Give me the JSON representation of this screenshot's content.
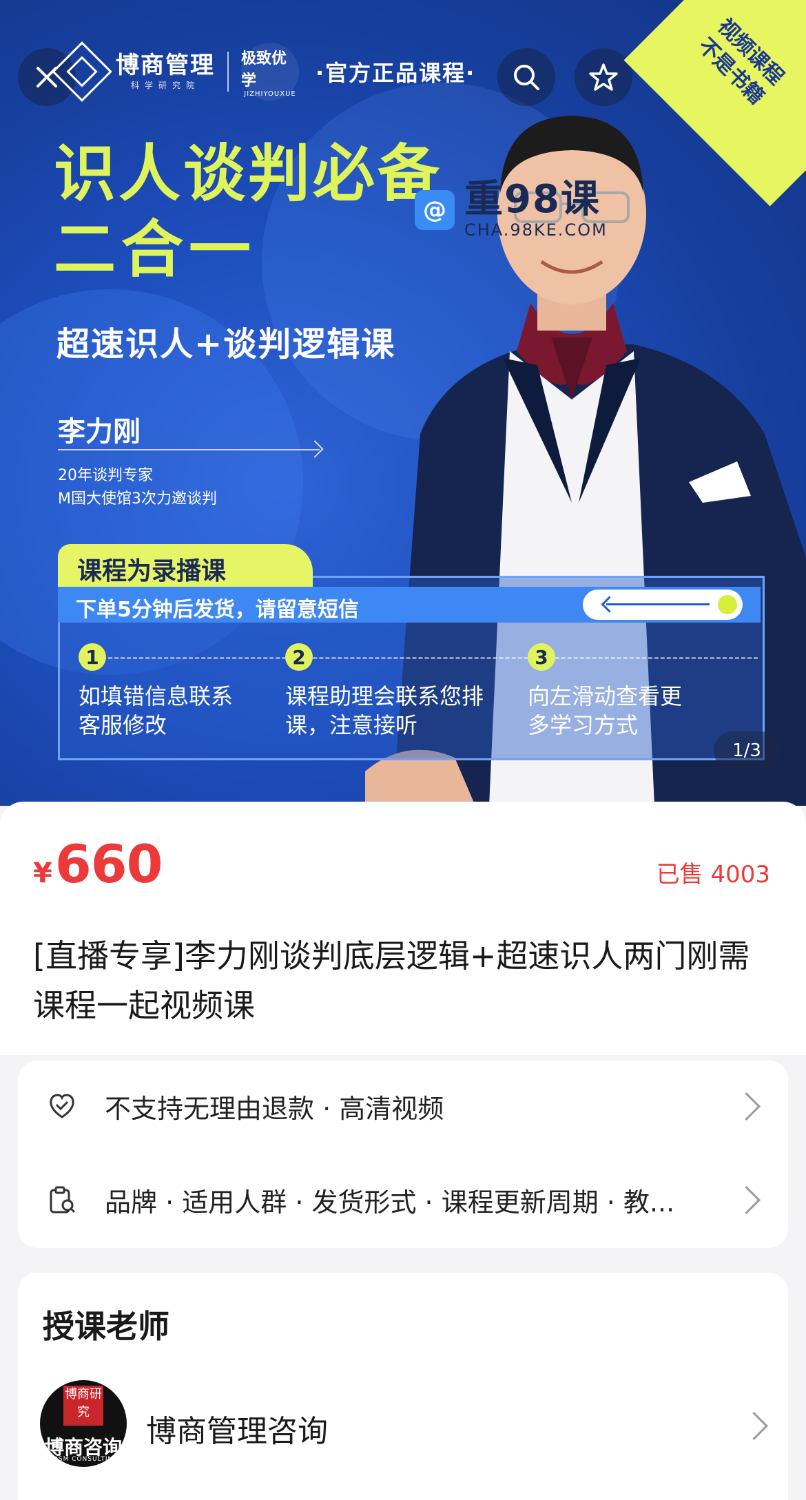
{
  "banner": {
    "brand_name": "博商管理",
    "brand_sub": "科学研究院",
    "partner_name": "极致优学",
    "partner_sub": "JIZHIYOUXUE",
    "official_label": "·官方正品课程·",
    "corner_tag_line1": "视频课程",
    "corner_tag_line2": "不是书籍",
    "headline_line1": "识人谈判必备",
    "headline_line2": "二合一",
    "subheadline": "超速识人+谈判逻辑课",
    "watermark_main": "重98课",
    "watermark_url": "CHA.98KE.COM",
    "teacher_name": "李力刚",
    "teacher_desc1": "20年谈判专家",
    "teacher_desc2": "M国大使馆3次力邀谈判",
    "notice_tab": "课程为录播课",
    "notice_strip": "下单5分钟后发货，请留意短信",
    "steps": [
      {
        "num": "1",
        "text": "如填错信息联系客服修改"
      },
      {
        "num": "2",
        "text": "课程助理会联系您排课，注意接听"
      },
      {
        "num": "3",
        "text": "向左滑动查看更多学习方式"
      }
    ],
    "pager": "1/3",
    "icons": {
      "close": "close-icon",
      "search": "search-icon",
      "favorite": "star-icon",
      "share": "share-icon",
      "more": "more-icon"
    }
  },
  "product": {
    "currency": "¥",
    "price": "660",
    "sold": "已售 4003",
    "title": "[直播专享]李力刚谈判底层逻辑+超速识人两门刚需课程一起视频课"
  },
  "info": {
    "service_text": "不支持无理由退款 · 高清视频",
    "params_text": "品牌 · 适用人群 · 发货形式 · 课程更新周期 · 教..."
  },
  "teacher": {
    "section_title": "授课老师",
    "name": "博商管理咨询",
    "avatar_seal": "博商研究",
    "avatar_text": "博商咨询",
    "avatar_sub": "BOSM CONSULTING"
  },
  "colors": {
    "accent_red": "#ec3a3a",
    "highlight_yellow": "#dff35a",
    "banner_blue": "#1e4fbf"
  }
}
